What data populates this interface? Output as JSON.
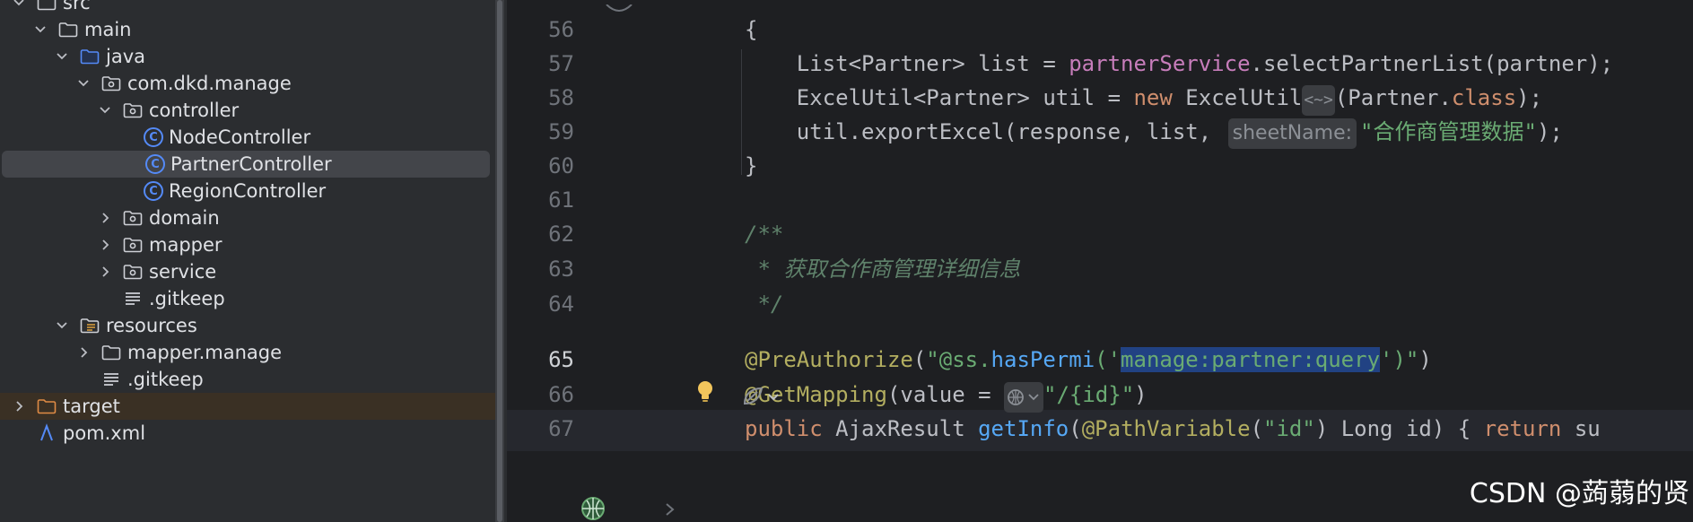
{
  "project_tree": {
    "items": [
      {
        "id": "src",
        "label": "src",
        "indent": 0,
        "arrow": "down",
        "icon": "folder-icon"
      },
      {
        "id": "main",
        "label": "main",
        "indent": 1,
        "arrow": "down",
        "icon": "folder-icon"
      },
      {
        "id": "java",
        "label": "java",
        "indent": 2,
        "arrow": "down",
        "icon": "source-folder-icon"
      },
      {
        "id": "com-dkd-manage",
        "label": "com.dkd.manage",
        "indent": 3,
        "arrow": "down",
        "icon": "package-icon"
      },
      {
        "id": "controller",
        "label": "controller",
        "indent": 4,
        "arrow": "down",
        "icon": "package-icon"
      },
      {
        "id": "node-controller",
        "label": "NodeController",
        "indent": 5,
        "arrow": "none",
        "icon": "class-icon"
      },
      {
        "id": "partner-controller",
        "label": "PartnerController",
        "indent": 5,
        "arrow": "none",
        "icon": "class-icon",
        "selected": true
      },
      {
        "id": "region-controller",
        "label": "RegionController",
        "indent": 5,
        "arrow": "none",
        "icon": "class-icon"
      },
      {
        "id": "domain",
        "label": "domain",
        "indent": 4,
        "arrow": "right",
        "icon": "package-icon"
      },
      {
        "id": "mapper",
        "label": "mapper",
        "indent": 4,
        "arrow": "right",
        "icon": "package-icon"
      },
      {
        "id": "service",
        "label": "service",
        "indent": 4,
        "arrow": "right",
        "icon": "package-icon"
      },
      {
        "id": "gitkeep-1",
        "label": ".gitkeep",
        "indent": 4,
        "arrow": "none",
        "icon": "text-file-icon"
      },
      {
        "id": "resources",
        "label": "resources",
        "indent": 2,
        "arrow": "down",
        "icon": "resources-folder-icon"
      },
      {
        "id": "mapper-manage",
        "label": "mapper.manage",
        "indent": 3,
        "arrow": "right",
        "icon": "folder-icon"
      },
      {
        "id": "gitkeep-2",
        "label": ".gitkeep",
        "indent": 3,
        "arrow": "none",
        "icon": "text-file-icon"
      },
      {
        "id": "target",
        "label": "target",
        "indent": 0,
        "arrow": "right",
        "icon": "excluded-folder-icon",
        "excluded": true
      },
      {
        "id": "pom-xml",
        "label": "pom.xml",
        "indent": 0,
        "arrow": "none",
        "icon": "maven-icon"
      }
    ]
  },
  "editor": {
    "current_line": 65,
    "lines": [
      {
        "n": "56",
        "tokens": [
          [
            "{",
            ""
          ]
        ]
      },
      {
        "n": "57",
        "tokens": [
          [
            "    List<Partner> list = ",
            ""
          ],
          [
            "partnerService",
            "field"
          ],
          [
            ".selectPartnerList(partner);",
            ""
          ]
        ]
      },
      {
        "n": "58",
        "tokens": [
          [
            "    ExcelUtil<Partner> util = ",
            ""
          ],
          [
            "new",
            "kw"
          ],
          [
            " ExcelUtil",
            ""
          ],
          [
            "<~>",
            "fold"
          ],
          [
            "(Partner.",
            ""
          ],
          [
            "class",
            "kw"
          ],
          [
            ");",
            ""
          ]
        ]
      },
      {
        "n": "59",
        "tokens": [
          [
            "    util.exportExcel(response, list, ",
            ""
          ],
          [
            "sheetName:",
            "hint"
          ],
          [
            "\"合作商管理数据\"",
            "str"
          ],
          [
            ");",
            ""
          ]
        ]
      },
      {
        "n": "60",
        "tokens": [
          [
            "}",
            ""
          ]
        ]
      },
      {
        "n": "61",
        "tokens": []
      },
      {
        "n": "62",
        "tokens": [
          [
            "/**",
            "doc"
          ]
        ]
      },
      {
        "n": "63",
        "tokens": [
          [
            " * 获取合作商管理详细信息",
            "doc"
          ]
        ]
      },
      {
        "n": "64",
        "tokens": [
          [
            " */",
            "doc"
          ]
        ]
      },
      {
        "n": "65",
        "tokens": [
          [
            "@PreAuthorize",
            "anno"
          ],
          [
            "(",
            ""
          ],
          [
            "\"@ss.",
            "str"
          ],
          [
            "hasPermi",
            "method"
          ],
          [
            "('",
            "str"
          ],
          [
            "manage:partner:query",
            "strsel"
          ],
          [
            "')\"",
            "str"
          ],
          [
            ")",
            ""
          ]
        ]
      },
      {
        "n": "66",
        "tokens": [
          [
            "@GetMapping",
            "anno"
          ],
          [
            "(value = ",
            ""
          ],
          [
            "globe-hint",
            "globe"
          ],
          [
            "\"/{id}\"",
            "str"
          ],
          [
            ")",
            ""
          ]
        ]
      },
      {
        "n": "67",
        "tokens": [
          [
            "public ",
            "kw"
          ],
          [
            "AjaxResult ",
            ""
          ],
          [
            "getInfo",
            "method"
          ],
          [
            "(",
            ""
          ],
          [
            "@PathVariable",
            "anno"
          ],
          [
            "(",
            ""
          ],
          [
            "\"id\"",
            "str"
          ],
          [
            ") Long id) { ",
            ""
          ],
          [
            "return ",
            "kw"
          ],
          [
            "su",
            ""
          ]
        ]
      }
    ],
    "watermark": "CSDN @蒟蒻的贤"
  }
}
